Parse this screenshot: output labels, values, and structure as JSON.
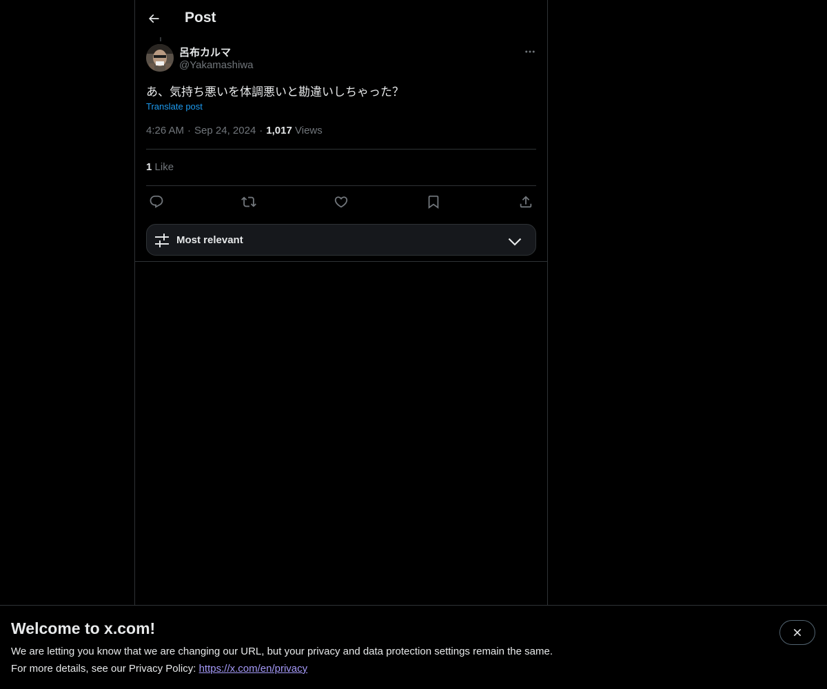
{
  "header": {
    "title": "Post",
    "back_icon": "arrow-left-icon"
  },
  "post": {
    "author": {
      "display_name": "呂布カルマ",
      "handle": "@Yakamashiwa"
    },
    "text": "あ、気持ち悪いを体調悪いと勘違いしちゃった？",
    "translate_label": "Translate post",
    "time": "4:26 AM",
    "date": "Sep 24, 2024",
    "views_count": "1,017",
    "views_label": "Views",
    "likes_count": "1",
    "likes_label": "Like",
    "separator": "·"
  },
  "actions": {
    "reply_icon": "reply-icon",
    "repost_icon": "repost-icon",
    "like_icon": "heart-icon",
    "bookmark_icon": "bookmark-icon",
    "share_icon": "share-icon"
  },
  "sort": {
    "label": "Most relevant"
  },
  "banner": {
    "title": "Welcome to x.com!",
    "line1": "We are letting you know that we are changing our URL, but your privacy and data protection settings remain the same.",
    "line2_prefix": "For more details, see our Privacy Policy: ",
    "link_text": "https://x.com/en/privacy"
  },
  "colors": {
    "background": "#000000",
    "text_primary": "#e7e9ea",
    "text_secondary": "#71767b",
    "accent": "#1d9bf0",
    "border": "#2f3336",
    "link_visited": "#a59af9"
  }
}
